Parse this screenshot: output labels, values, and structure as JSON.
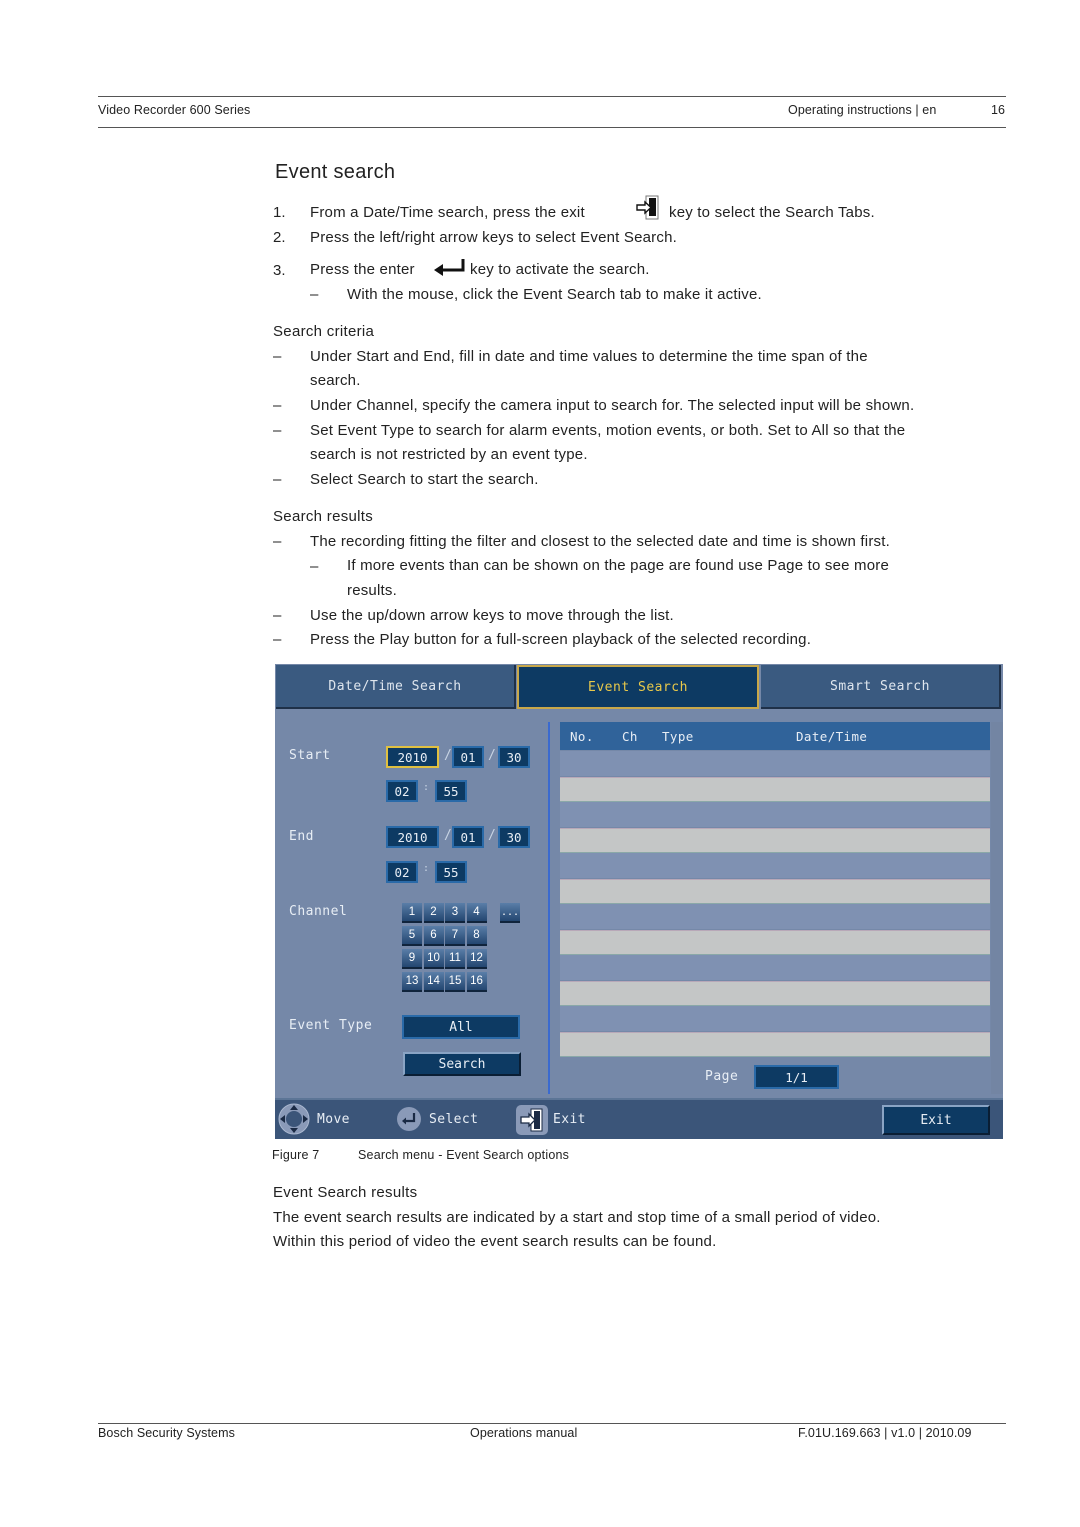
{
  "header": {
    "left": "Video Recorder 600 Series",
    "right": "Operating instructions | en",
    "page_number": "16"
  },
  "section_title": "Event search",
  "steps": [
    {
      "num": "1.",
      "before_icon": "From a Date/Time search, press the exit",
      "icon": "exit-key-icon",
      "after_icon": "key to select the Search Tabs."
    },
    {
      "num": "2.",
      "text": "Press the left/right arrow keys to select Event Search."
    },
    {
      "num": "3.",
      "before_icon": "Press the enter",
      "icon": "enter-key-icon",
      "after_icon": "key to activate the search."
    }
  ],
  "step3_sub": "With the mouse, click the Event Search tab to make it active.",
  "search_criteria": {
    "title": "Search criteria",
    "items": [
      {
        "lines": [
          "Under Start and End, fill in date and time values to determine the time span of the",
          "search."
        ]
      },
      {
        "lines": [
          "Under Channel, specify the camera input to search for. The selected input will be shown."
        ]
      },
      {
        "lines": [
          "Set Event Type to search for alarm events, motion events, or both. Set to All so that the",
          "search is not restricted by an event type."
        ]
      },
      {
        "lines": [
          "Select Search to start the search."
        ]
      }
    ]
  },
  "search_results": {
    "title": "Search results",
    "item1": "The recording fitting the filter and closest to the selected date and time is shown first.",
    "item1_sub": [
      "If more events than can be shown on the page are found use Page to see more",
      "results."
    ],
    "item2": "Use the up/down arrow keys to move through the list.",
    "item3": "Press the Play button for a full-screen playback of the selected recording."
  },
  "dash": "–",
  "dvr_ui": {
    "tabs": [
      "Date/Time Search",
      "Event Search",
      "Smart Search"
    ],
    "active_tab": "Event Search",
    "start_label": "Start",
    "end_label": "End",
    "start": {
      "year": "2010",
      "month": "01",
      "day": "30",
      "hour": "02",
      "minute": "55"
    },
    "end": {
      "year": "2010",
      "month": "01",
      "day": "30",
      "hour": "02",
      "minute": "55"
    },
    "date_sep": "/",
    "time_sep": ":",
    "channel_label": "Channel",
    "channels": [
      "1",
      "2",
      "3",
      "4",
      "5",
      "6",
      "7",
      "8",
      "9",
      "10",
      "11",
      "12",
      "13",
      "14",
      "15",
      "16"
    ],
    "more_channels": "...",
    "event_type_label": "Event Type",
    "event_type_value": "All",
    "search_button": "Search",
    "table_headers": [
      "No.",
      "Ch",
      "Type",
      "Date/Time"
    ],
    "table_rows": 12,
    "page_label": "Page",
    "page_value": "1/1",
    "footer": {
      "move": "Move",
      "select": "Select",
      "exit": "Exit",
      "exit_button": "Exit"
    },
    "colors": {
      "active_tab_text": "#e8c84a",
      "field_bg": "#0d3a63",
      "panel_bg": "#7588a8",
      "header_bg": "#30639a"
    }
  },
  "figure_caption": {
    "label": "Figure 7",
    "text": "Search menu - Event Search options"
  },
  "event_search_results": {
    "title": "Event Search results",
    "lines": [
      "The event search results are indicated by a start and stop time of a small period of video.",
      "Within this period of video the event search results can be found."
    ]
  },
  "footer": {
    "left": "Bosch Security Systems",
    "center": "Operations manual",
    "right": "F.01U.169.663 | v1.0 | 2010.09"
  }
}
